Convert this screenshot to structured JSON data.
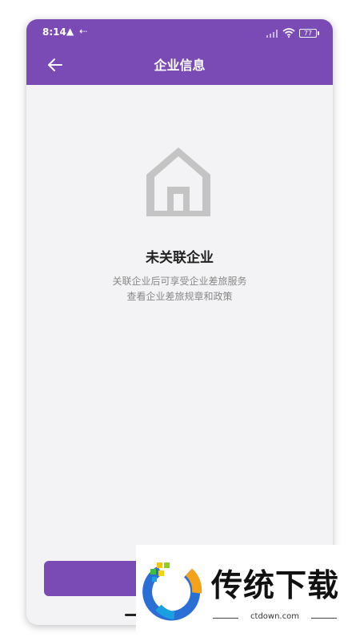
{
  "status_bar": {
    "time": "8:14",
    "battery": "77"
  },
  "header": {
    "title": "企业信息"
  },
  "empty_state": {
    "title": "未关联企业",
    "desc_line1": "关联企业后可享受企业差旅服务",
    "desc_line2": "查看企业差旅规章和政策"
  },
  "watermark": {
    "brand": "传统下载",
    "url": "ctdown.com"
  },
  "colors": {
    "accent": "#7a4bb4",
    "background": "#f3f2f4",
    "icon_gray": "#c4c4c4"
  }
}
